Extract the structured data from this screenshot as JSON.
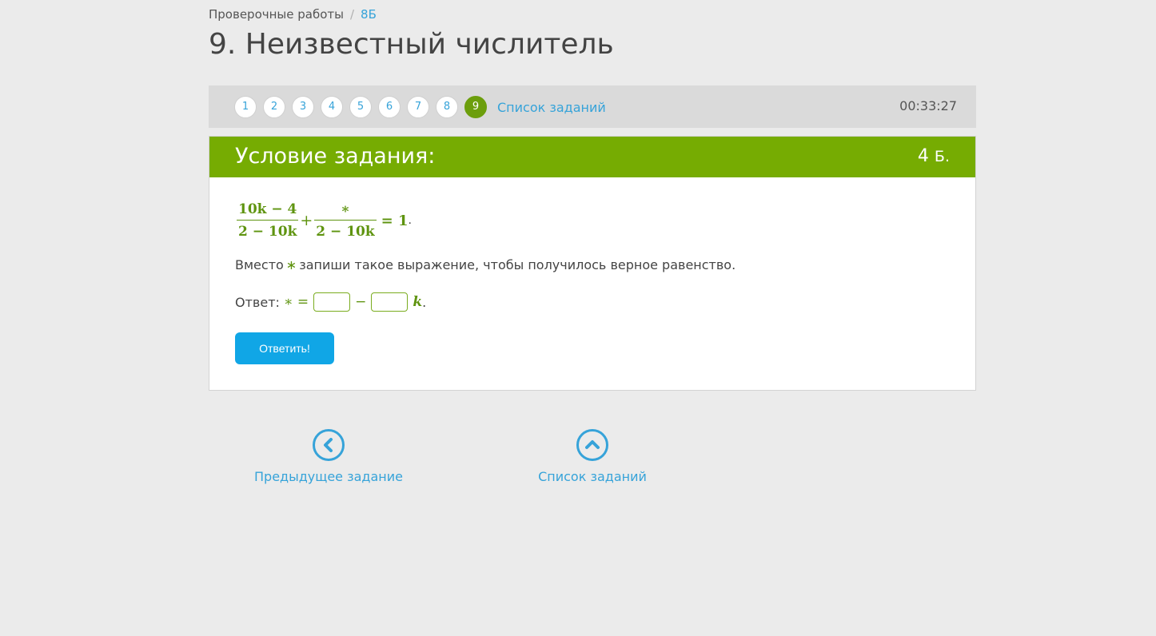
{
  "breadcrumb": {
    "root": "Проверочные работы",
    "separator": "/",
    "current": "8Б"
  },
  "page_title": "9. Неизвестный числитель",
  "task_nav": {
    "numbers": [
      "1",
      "2",
      "3",
      "4",
      "5",
      "6",
      "7",
      "8",
      "9"
    ],
    "active": "9",
    "list_link": "Список заданий",
    "timer": "00:33:27"
  },
  "task": {
    "header_title": "Условие задания:",
    "points_value": "4",
    "points_unit": "Б.",
    "formula": {
      "frac1_num": "10k − 4",
      "frac1_den": "2 − 10k",
      "plus": "+",
      "frac2_num": "∗",
      "frac2_den": "2 − 10k",
      "rhs": "= 1",
      "period": "."
    },
    "instruction": {
      "before": "Вместо",
      "star": "∗",
      "after": "запиши такое выражение, чтобы получилось верное равенство."
    },
    "answer": {
      "label": "Ответ:",
      "star_eq": "∗ =",
      "minus": "−",
      "variable": "k",
      "period": ".",
      "input1_value": "",
      "input2_value": ""
    },
    "submit_label": "Ответить!"
  },
  "bottom_nav": {
    "prev_label": "Предыдущее задание",
    "list_label": "Список заданий"
  },
  "colors": {
    "accent_green": "#76ac02",
    "link_blue": "#36a3d9",
    "button_blue": "#10a6e6",
    "background": "#ebebeb"
  }
}
